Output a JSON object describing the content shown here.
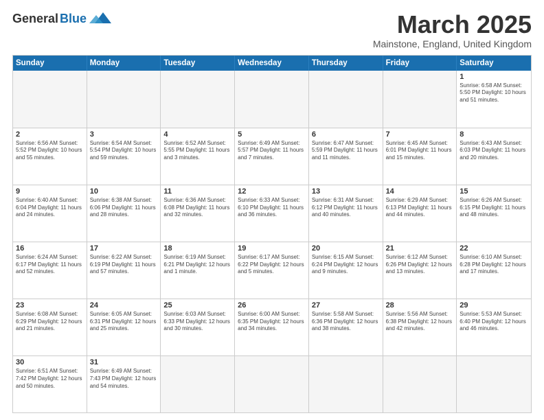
{
  "logo": {
    "general": "General",
    "blue": "Blue"
  },
  "title": "March 2025",
  "location": "Mainstone, England, United Kingdom",
  "days": [
    "Sunday",
    "Monday",
    "Tuesday",
    "Wednesday",
    "Thursday",
    "Friday",
    "Saturday"
  ],
  "weeks": [
    [
      {
        "day": "",
        "info": "",
        "empty": true
      },
      {
        "day": "",
        "info": "",
        "empty": true
      },
      {
        "day": "",
        "info": "",
        "empty": true
      },
      {
        "day": "",
        "info": "",
        "empty": true
      },
      {
        "day": "",
        "info": "",
        "empty": true
      },
      {
        "day": "",
        "info": "",
        "empty": true
      },
      {
        "day": "1",
        "info": "Sunrise: 6:58 AM\nSunset: 5:50 PM\nDaylight: 10 hours and 51 minutes.",
        "empty": false
      }
    ],
    [
      {
        "day": "2",
        "info": "Sunrise: 6:56 AM\nSunset: 5:52 PM\nDaylight: 10 hours and 55 minutes.",
        "empty": false
      },
      {
        "day": "3",
        "info": "Sunrise: 6:54 AM\nSunset: 5:54 PM\nDaylight: 10 hours and 59 minutes.",
        "empty": false
      },
      {
        "day": "4",
        "info": "Sunrise: 6:52 AM\nSunset: 5:55 PM\nDaylight: 11 hours and 3 minutes.",
        "empty": false
      },
      {
        "day": "5",
        "info": "Sunrise: 6:49 AM\nSunset: 5:57 PM\nDaylight: 11 hours and 7 minutes.",
        "empty": false
      },
      {
        "day": "6",
        "info": "Sunrise: 6:47 AM\nSunset: 5:59 PM\nDaylight: 11 hours and 11 minutes.",
        "empty": false
      },
      {
        "day": "7",
        "info": "Sunrise: 6:45 AM\nSunset: 6:01 PM\nDaylight: 11 hours and 15 minutes.",
        "empty": false
      },
      {
        "day": "8",
        "info": "Sunrise: 6:43 AM\nSunset: 6:03 PM\nDaylight: 11 hours and 20 minutes.",
        "empty": false
      }
    ],
    [
      {
        "day": "9",
        "info": "Sunrise: 6:40 AM\nSunset: 6:04 PM\nDaylight: 11 hours and 24 minutes.",
        "empty": false
      },
      {
        "day": "10",
        "info": "Sunrise: 6:38 AM\nSunset: 6:06 PM\nDaylight: 11 hours and 28 minutes.",
        "empty": false
      },
      {
        "day": "11",
        "info": "Sunrise: 6:36 AM\nSunset: 6:08 PM\nDaylight: 11 hours and 32 minutes.",
        "empty": false
      },
      {
        "day": "12",
        "info": "Sunrise: 6:33 AM\nSunset: 6:10 PM\nDaylight: 11 hours and 36 minutes.",
        "empty": false
      },
      {
        "day": "13",
        "info": "Sunrise: 6:31 AM\nSunset: 6:12 PM\nDaylight: 11 hours and 40 minutes.",
        "empty": false
      },
      {
        "day": "14",
        "info": "Sunrise: 6:29 AM\nSunset: 6:13 PM\nDaylight: 11 hours and 44 minutes.",
        "empty": false
      },
      {
        "day": "15",
        "info": "Sunrise: 6:26 AM\nSunset: 6:15 PM\nDaylight: 11 hours and 48 minutes.",
        "empty": false
      }
    ],
    [
      {
        "day": "16",
        "info": "Sunrise: 6:24 AM\nSunset: 6:17 PM\nDaylight: 11 hours and 52 minutes.",
        "empty": false
      },
      {
        "day": "17",
        "info": "Sunrise: 6:22 AM\nSunset: 6:19 PM\nDaylight: 11 hours and 57 minutes.",
        "empty": false
      },
      {
        "day": "18",
        "info": "Sunrise: 6:19 AM\nSunset: 6:21 PM\nDaylight: 12 hours and 1 minute.",
        "empty": false
      },
      {
        "day": "19",
        "info": "Sunrise: 6:17 AM\nSunset: 6:22 PM\nDaylight: 12 hours and 5 minutes.",
        "empty": false
      },
      {
        "day": "20",
        "info": "Sunrise: 6:15 AM\nSunset: 6:24 PM\nDaylight: 12 hours and 9 minutes.",
        "empty": false
      },
      {
        "day": "21",
        "info": "Sunrise: 6:12 AM\nSunset: 6:26 PM\nDaylight: 12 hours and 13 minutes.",
        "empty": false
      },
      {
        "day": "22",
        "info": "Sunrise: 6:10 AM\nSunset: 6:28 PM\nDaylight: 12 hours and 17 minutes.",
        "empty": false
      }
    ],
    [
      {
        "day": "23",
        "info": "Sunrise: 6:08 AM\nSunset: 6:29 PM\nDaylight: 12 hours and 21 minutes.",
        "empty": false
      },
      {
        "day": "24",
        "info": "Sunrise: 6:05 AM\nSunset: 6:31 PM\nDaylight: 12 hours and 25 minutes.",
        "empty": false
      },
      {
        "day": "25",
        "info": "Sunrise: 6:03 AM\nSunset: 6:33 PM\nDaylight: 12 hours and 30 minutes.",
        "empty": false
      },
      {
        "day": "26",
        "info": "Sunrise: 6:00 AM\nSunset: 6:35 PM\nDaylight: 12 hours and 34 minutes.",
        "empty": false
      },
      {
        "day": "27",
        "info": "Sunrise: 5:58 AM\nSunset: 6:36 PM\nDaylight: 12 hours and 38 minutes.",
        "empty": false
      },
      {
        "day": "28",
        "info": "Sunrise: 5:56 AM\nSunset: 6:38 PM\nDaylight: 12 hours and 42 minutes.",
        "empty": false
      },
      {
        "day": "29",
        "info": "Sunrise: 5:53 AM\nSunset: 6:40 PM\nDaylight: 12 hours and 46 minutes.",
        "empty": false
      }
    ],
    [
      {
        "day": "30",
        "info": "Sunrise: 6:51 AM\nSunset: 7:42 PM\nDaylight: 12 hours and 50 minutes.",
        "empty": false
      },
      {
        "day": "31",
        "info": "Sunrise: 6:49 AM\nSunset: 7:43 PM\nDaylight: 12 hours and 54 minutes.",
        "empty": false
      },
      {
        "day": "",
        "info": "",
        "empty": true
      },
      {
        "day": "",
        "info": "",
        "empty": true
      },
      {
        "day": "",
        "info": "",
        "empty": true
      },
      {
        "day": "",
        "info": "",
        "empty": true
      },
      {
        "day": "",
        "info": "",
        "empty": true
      }
    ]
  ]
}
